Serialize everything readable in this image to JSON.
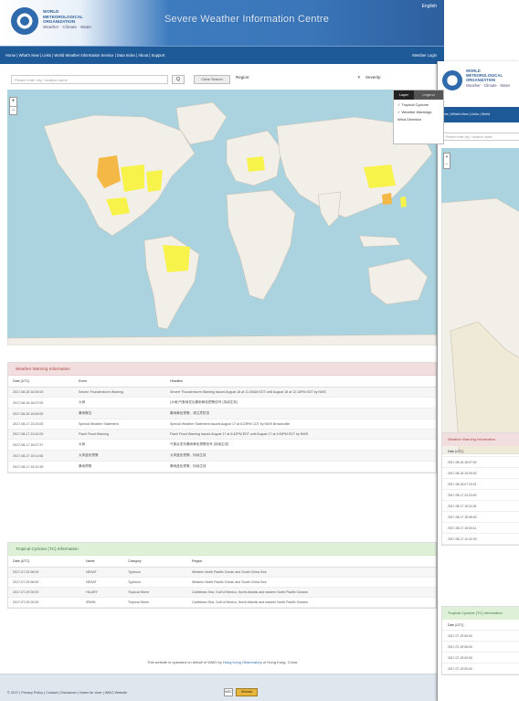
{
  "header": {
    "org_name": "WORLD METEOROLOGICAL ORGANIZATION",
    "org_tagline": "Weather · Climate · Water",
    "site_title": "Severe Weather Information Centre",
    "language": "English"
  },
  "nav": {
    "links": "Home | What's New | Links | World Weather Information Service | Data Index | About | Support",
    "login": "Member Login"
  },
  "toolbar": {
    "search_placeholder": "Please enter city / location name",
    "search_button": "Q",
    "clear_button": "Clear Search",
    "region_label": "Region:",
    "region_arrow": "▾",
    "severity_label": "Severity:"
  },
  "map": {
    "zoom_in": "+",
    "zoom_out": "−",
    "layer_tab_1": "Layer",
    "layer_tab_2": "Legend",
    "layer_options": [
      "✓ Tropical Cyclone",
      "✓ Weather Warnings",
      "Wind Direction"
    ]
  },
  "warnings": {
    "title": "Weather Warning Information",
    "columns": [
      "Date (UTC)",
      "Event",
      "Headline"
    ],
    "rows": [
      [
        "2017-08-18 16:30:00",
        "Severe Thunderstorm Warning",
        "Severe Thunderstorm Warning issued August 18 at 11:30AM EDT until August 18 at 12:15PM EDT by NWS"
      ],
      [
        "2017-08-18 16:07:00",
        "大雨",
        "(大雨)气象局发出暴雨黄色预警信号 (持续生效)"
      ],
      [
        "2017-08-18 15:00:00",
        "暴雨警告",
        "暴雨黄色预警，请注意防范"
      ],
      [
        "2017-08-17 23:23:00",
        "Special Weather Statement",
        "Special Weather Statement issued August 17 at 6:23PM CDT by NWS Brownsville"
      ],
      [
        "2017-08-17 22:42:00",
        "Flash Flood Warning",
        "Flash Flood Warning issued August 17 at 6:42PM EDT until August 17 at 9:45PM EDT by NWS"
      ],
      [
        "2017-08-17 16:07:37",
        "大雨",
        "气象台发布暴雨黄色预警信号 (持续生效)"
      ],
      [
        "2017-08-17 15:11:06",
        "大风蓝色预警",
        "大风蓝色预警，持续生效"
      ],
      [
        "2017-08-17 15:10:39",
        "暴雨预警",
        "暴雨蓝色预警，持续生效"
      ]
    ]
  },
  "cyclones": {
    "title": "Tropical Cyclone (TC) Information",
    "columns": [
      "Date (UTC)",
      "Name",
      "Category",
      "Region"
    ],
    "rows": [
      [
        "2017-07-29 06:00",
        "NESAT",
        "Typhoon",
        "Western North Pacific Ocean and South China Sea"
      ],
      [
        "2017-07-29 06:00",
        "NESAT",
        "Typhoon",
        "Western North Pacific Ocean and South China Sea"
      ],
      [
        "2017-07-29 00:00",
        "HILARY",
        "Tropical Storm",
        "Caribbean Sea, Gulf of Mexico, North Atlantic and eastern North Pacific Oceans"
      ],
      [
        "2017-07-29 00:00",
        "IRWIN",
        "Tropical Storm",
        "Caribbean Sea, Gulf of Mexico, North Atlantic and eastern North Pacific Oceans"
      ]
    ]
  },
  "footnote": {
    "prefix": "This website is operated on behalf of WMO by",
    "operator": "Hong Kong Observatory",
    "suffix": "of Hong Kong, China"
  },
  "footer": {
    "links": "© 2017 | Privacy Policy | Contact | Disclaimer | Notes for User | WMO Website",
    "badge1": "W3C",
    "badge2": "Website"
  },
  "side": {
    "org_name": "WORLD METEOROLOGICAL ORGANIZATION",
    "org_tagline": "Weather · Climate · Water",
    "nav": "Home | What's New | Links | World",
    "search_placeholder": "Please enter city / location name",
    "zoom_in": "+",
    "zoom_out": "−",
    "warn_title": "Weather Warning Information",
    "warn_header": "Date (UTC)",
    "warn_rows": [
      "2017-08-18 16:07:00",
      "2017-08-18 15:00:00",
      "2017-08-18 07:10:01",
      "2017-08-17 23:23:00",
      "2017-08-17 15:11:06",
      "2017-08-17 15:06:00",
      "2017-08-17 15:03:11",
      "2017-08-17 12:42:33"
    ],
    "tc_title": "Tropical Cyclone (TC) Information",
    "tc_header": "Date (UTC)",
    "tc_rows": [
      "2017-07-29 06:00",
      "2017-07-29 06:00",
      "2017-07-29 00:00",
      "2017-07-29 00:00"
    ]
  },
  "colors": {
    "nav_blue": "#1f5a98",
    "ocean": "#aad3df",
    "land": "#f2efe9",
    "warn_yellow": "#f7f34a",
    "warn_orange": "#f4b846",
    "warn_header_bg": "#f2dede",
    "tc_header_bg": "#dff0d8"
  }
}
